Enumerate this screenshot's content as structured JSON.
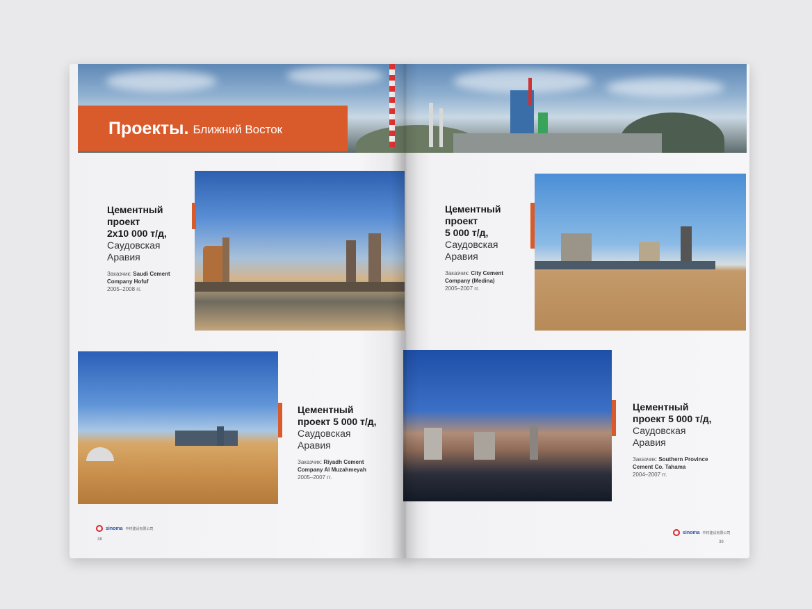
{
  "header": {
    "title_bold": "Проекты.",
    "title_light": "Ближний Восток"
  },
  "projects": [
    {
      "heading": "Цементный\nпроект\n2x10 000 т/д,",
      "location": "Саудовская\nАравия",
      "client_label": "Заказчик:",
      "client_name": "Saudi Cement\nCompany Hofuf",
      "years": "2005–2008 гг."
    },
    {
      "heading": "Цементный\nпроект\n5 000 т/д,",
      "location": "Саудовская\nАравия",
      "client_label": "Заказчик:",
      "client_name": "City Cement\nCompany (Medina)",
      "years": "2005–2007 гг."
    },
    {
      "heading": "Цементный\nпроект 5 000 т/д,",
      "location": "Саудовская\nАравия",
      "client_label": "Заказчик:",
      "client_name": "Riyadh Cement\nCompany Al Muzahmeyah",
      "years": "2005–2007 гг."
    },
    {
      "heading": "Цементный\nпроект 5 000 т/д,",
      "location": "Саудовская\nАравия",
      "client_label": "Заказчик:",
      "client_name": "Southern Province\nCement Co. Tahama",
      "years": "2004–2007 гг."
    }
  ],
  "footer": {
    "brand": "sinoma",
    "cn_name": "中材建设有限公司",
    "page_left": "38",
    "page_right": "39"
  },
  "colors": {
    "accent": "#d95a2b",
    "page": "#f4f4f6",
    "background": "#e9e9eb"
  }
}
